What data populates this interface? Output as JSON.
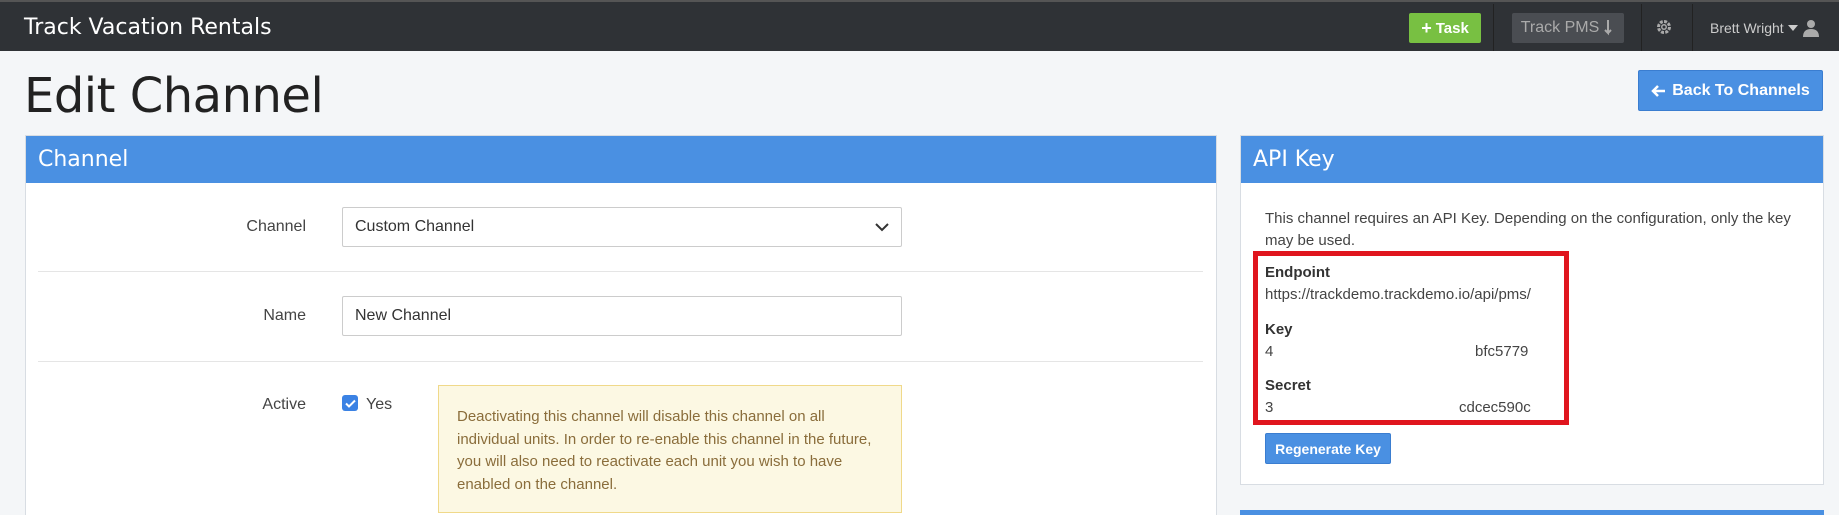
{
  "navbar": {
    "brand": "Track Vacation Rentals",
    "task_label": "Task",
    "pms_label": "Track PMS",
    "user_name": "Brett Wright"
  },
  "page": {
    "title": "Edit Channel",
    "back_label": "Back To Channels"
  },
  "channel_panel": {
    "title": "Channel",
    "channel_label": "Channel",
    "channel_value": "Custom Channel",
    "name_label": "Name",
    "name_value": "New Channel",
    "active_label": "Active",
    "active_checked": true,
    "active_option": "Yes",
    "warning_text": "Deactivating this channel will disable this channel on all individual units. In order to re-enable this channel in the future, you will also need to reactivate each unit you wish to have enabled on the channel."
  },
  "api_panel": {
    "title": "API Key",
    "description": "This channel requires an API Key. Depending on the configuration, only the key may be used.",
    "endpoint_label": "Endpoint",
    "endpoint_value": "https://trackdemo.trackdemo.io/api/pms/",
    "key_label": "Key",
    "key_prefix": "4",
    "key_suffix": "bfc5779",
    "secret_label": "Secret",
    "secret_prefix": "3",
    "secret_suffix": "cdcec590c",
    "regenerate_label": "Regenerate Key"
  },
  "colors": {
    "navbar": "#2f3236",
    "primary": "#4a90e2",
    "task_green": "#78c042",
    "highlight_red": "#e0151e",
    "warning_bg": "#fcf8e3"
  }
}
